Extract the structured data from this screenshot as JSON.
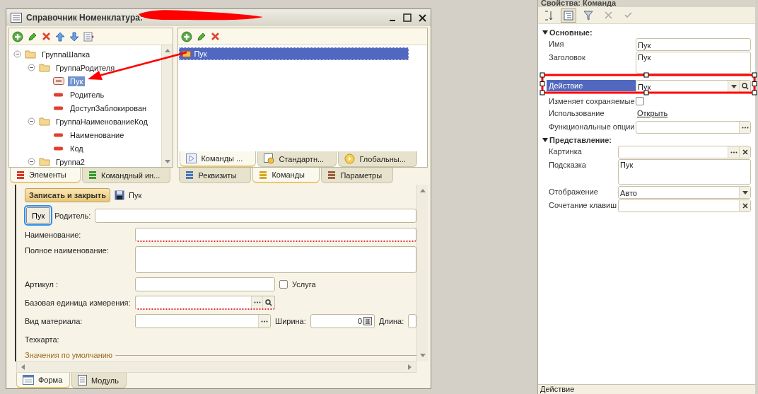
{
  "window": {
    "title": "Справочник Номенклатура:"
  },
  "elements_tree": [
    {
      "label": "ГруппаШапка",
      "kind": "group",
      "expanded": true,
      "selected": false,
      "children": [
        {
          "label": "ГруппаРодителя",
          "kind": "group",
          "expanded": true,
          "selected": false,
          "children": [
            {
              "label": "Пук",
              "kind": "button",
              "selected": true
            },
            {
              "label": "Родитель",
              "kind": "field",
              "selected": false
            },
            {
              "label": "ДоступЗаблокирован",
              "kind": "field",
              "selected": false
            }
          ]
        },
        {
          "label": "ГруппаНаименованиеКод",
          "kind": "group",
          "expanded": true,
          "selected": false,
          "children": [
            {
              "label": "Наименование",
              "kind": "field",
              "selected": false
            },
            {
              "label": "Код",
              "kind": "field",
              "selected": false
            }
          ]
        },
        {
          "label": "Группа2",
          "kind": "group",
          "expanded": true,
          "selected": false
        }
      ]
    }
  ],
  "left_tabs": [
    {
      "label": "Элементы",
      "selected": true,
      "color": "#d83a2c"
    },
    {
      "label": "Командный ин...",
      "selected": false,
      "color": "#3a9a30"
    }
  ],
  "commands": [
    {
      "label": "Пук",
      "selected": true
    }
  ],
  "command_subtabs": [
    {
      "label": "Команды ...",
      "selected": true
    },
    {
      "label": "Стандартн...",
      "selected": false
    },
    {
      "label": "Глобальны...",
      "selected": false
    }
  ],
  "right_tabs": [
    {
      "label": "Реквизиты",
      "selected": false,
      "color": "#4a78b8"
    },
    {
      "label": "Команды",
      "selected": true,
      "color": "#d8a820"
    },
    {
      "label": "Параметры",
      "selected": false,
      "color": "#9a6040"
    }
  ],
  "form": {
    "save_button": "Записать и закрыть",
    "caption": "Пук",
    "command_button": "Пук",
    "parent_label": "Родитель:",
    "fields": [
      {
        "label": "Наименование:",
        "kind": "text",
        "required": true
      },
      {
        "label": "Полное наименование:",
        "kind": "textarea",
        "required": false
      },
      {
        "label": "Артикул :",
        "kind": "text",
        "required": false,
        "checkbox": {
          "label": "Услуга",
          "checked": false
        }
      },
      {
        "label": "Базовая единица измерения:",
        "kind": "lookup",
        "required": true
      },
      {
        "label": "Вид материала:",
        "kind": "choice",
        "required": false,
        "width_label": "Ширина:",
        "width_value": "0",
        "length_label": "Длина:"
      },
      {
        "label": "Техкарта:",
        "kind": "label"
      }
    ],
    "section": "Значения по умолчанию"
  },
  "bottom_tabs": [
    {
      "label": "Форма",
      "selected": true
    },
    {
      "label": "Модуль",
      "selected": false
    }
  ],
  "properties": {
    "title": "Свойства: Команда",
    "sections": [
      {
        "title": "Основные:",
        "expanded": true,
        "rows": [
          {
            "label": "Имя",
            "kind": "text",
            "value": "Пук",
            "selected": false
          },
          {
            "label": "Заголовок",
            "kind": "textarea",
            "value": "Пук",
            "selected": false
          },
          {
            "label": "Действие",
            "kind": "select",
            "value": "Пук",
            "selected": true
          },
          {
            "label": "Изменяет сохраняемые",
            "kind": "checkbox",
            "checked": false,
            "selected": false
          },
          {
            "label": "Использование",
            "kind": "link",
            "value": "Открыть",
            "selected": false
          },
          {
            "label": "Функциональные опции",
            "kind": "choice",
            "selected": false
          }
        ]
      },
      {
        "title": "Представление:",
        "expanded": true,
        "rows": [
          {
            "label": "Картинка",
            "kind": "clearchoice",
            "selected": false
          },
          {
            "label": "Подсказка",
            "kind": "textarea",
            "value": "Пук",
            "selected": false
          },
          {
            "label": "Отображение",
            "kind": "dropdown",
            "value": "Авто",
            "selected": false
          },
          {
            "label": "Сочетание клавиш",
            "kind": "clear",
            "selected": false
          }
        ]
      }
    ],
    "status": "Действие"
  }
}
